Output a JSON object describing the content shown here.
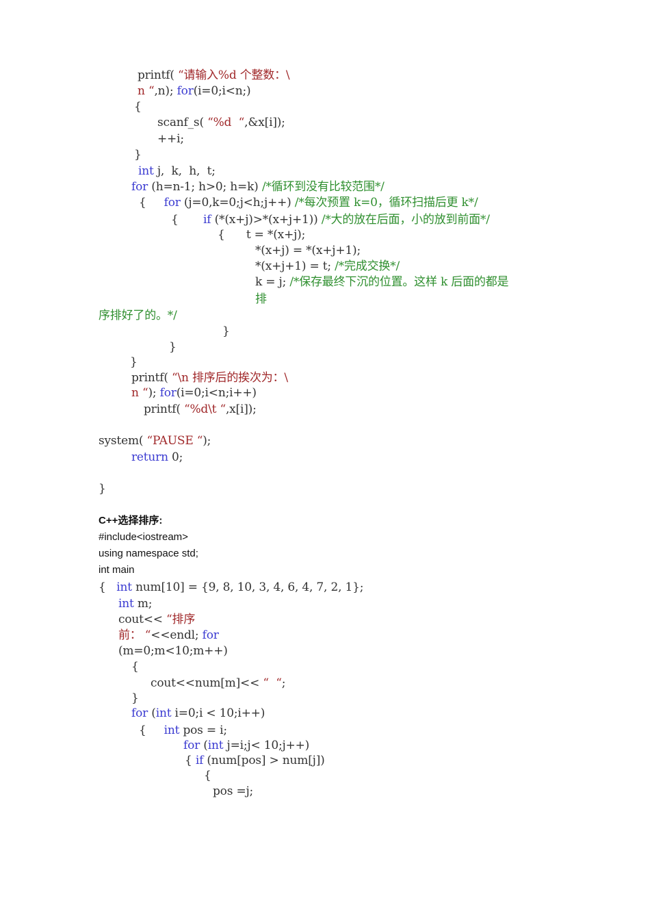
{
  "colors": {
    "text": "#333333",
    "keyword": "#3b3bd1",
    "string": "#a0282a",
    "comment": "#2f8f2f"
  },
  "bubble_sort_code": {
    "l01": [
      "printf( ",
      "“请输入%d 个整数：\\"
    ],
    "l02": [
      "n “",
      ",n); ",
      "for",
      "(i=0;i<n;)"
    ],
    "l03": "{",
    "l04": [
      "scanf_s( ",
      "“%d  “",
      ",&x[i]);"
    ],
    "l05": "++i;",
    "l06": "}",
    "l07": [
      "int",
      " j,  k,  h,  t;"
    ],
    "l08": [
      "for",
      " (h=n-1; h>0; h=k) ",
      "/*循环到没有比较范围*/"
    ],
    "l09": [
      "{     ",
      "for",
      " (j=0,k=0;j<h;j++) ",
      "/*每次预置 k=0，循环扫描后更 k*/"
    ],
    "l10": [
      "{       ",
      "if",
      " (*(x+j)>*(x+j+1)) ",
      "/*大的放在后面，小的放到前面*/"
    ],
    "l11": "{      t = *(x+j);",
    "l12": "*(x+j) = *(x+j+1);",
    "l13": [
      "*(x+j+1) = t; ",
      "/*完成交换*/"
    ],
    "l14": [
      "k = j; ",
      "/*保存最终下沉的位置。这样 k 后面的都是"
    ],
    "l15": "排",
    "l16": "序排好了的。*/",
    "l17": "}",
    "l18": "}",
    "l19": "}",
    "l20": [
      "printf( ",
      "“\\n 排序后的挨次为：\\"
    ],
    "l21": [
      "n “",
      "); ",
      "for",
      "(i=0;i<n;i++)"
    ],
    "l22": [
      "printf( ",
      "“%d\\t “",
      ",x[i]);"
    ],
    "l23": [
      "system( ",
      "“PAUSE “",
      ");"
    ],
    "l24": [
      "return",
      " 0;"
    ],
    "l25": "}"
  },
  "selection_sort": {
    "heading": "C++选择排序:",
    "include": "#include<iostream>",
    "using": "using namespace std;",
    "main": "int main",
    "code": {
      "l01": [
        "{   ",
        "int",
        " num[10] = {9, 8, 10, 3, 4, 6, 4, 7, 2, 1};"
      ],
      "l02": [
        "int",
        " m;"
      ],
      "l03": [
        "cout<< ",
        "“排序"
      ],
      "l04": [
        "前： “",
        "<<endl; ",
        "for"
      ],
      "l05": "(m=0;m<10;m++)",
      "l06": "{",
      "l07": [
        "cout<<num[m]<< ",
        "“  “",
        ";"
      ],
      "l08": "}",
      "l09": [
        "for",
        " (",
        "int",
        " i=0;i < 10;i++)"
      ],
      "l10": [
        "{     ",
        "int",
        " pos = i;"
      ],
      "l11": [
        "for",
        " (",
        "int",
        " j=i;j< 10;j++)"
      ],
      "l12": [
        "{ ",
        "if",
        " (num[pos] > num[j])"
      ],
      "l13": "{",
      "l14": "pos =j;"
    }
  }
}
